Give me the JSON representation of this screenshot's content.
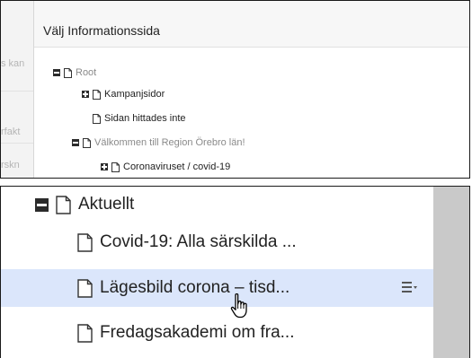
{
  "background": {
    "fragments": [
      "s kan",
      "rfakt",
      "rskn"
    ]
  },
  "dialog": {
    "title": "Välj Informationssida"
  },
  "tree_small": {
    "root": "Root",
    "kampanj": "Kampanjsidor",
    "not_found": "Sidan hittades inte",
    "valkommen": "Välkommen till Region Örebro län!",
    "corona": "Coronaviruset / covid-19"
  },
  "tree_zoom": {
    "aktuellt": "Aktuellt",
    "item1": "Covid-19: Alla särskilda ...",
    "item2": "Lägesbild corona – tisd...",
    "item3": "Fredagsakademi om fra..."
  },
  "colors": {
    "selected_row": "#dbe6fb",
    "scrollbar": "#c9c9c9"
  },
  "icons": [
    "minus-toggle-icon",
    "plus-toggle-icon",
    "document-icon",
    "context-menu-icon",
    "hand-cursor-icon"
  ]
}
